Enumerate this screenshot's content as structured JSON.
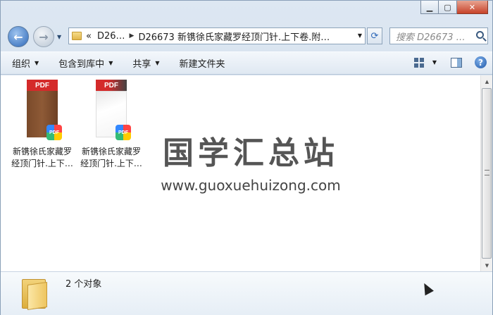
{
  "window": {
    "caption_buttons": [
      "minimize",
      "maximize",
      "close"
    ]
  },
  "address_bar": {
    "prefix": "«",
    "crumbs": [
      "D26…",
      "D26673 新镌徐氏家藏罗经顶门针.上下卷.附…"
    ]
  },
  "search": {
    "placeholder": "搜索 D26673 …"
  },
  "toolbar": {
    "organize": "组织",
    "include_in_library": "包含到库中",
    "share": "共享",
    "new_folder": "新建文件夹"
  },
  "files": [
    {
      "tag": "PDF",
      "badge": "PDF",
      "line1": "新镌徐氏家藏罗",
      "line2": "经顶门针.上下…"
    },
    {
      "tag": "PDF",
      "badge": "PDF",
      "line1": "新镌徐氏家藏罗",
      "line2": "经顶门针.上下…"
    }
  ],
  "watermark": {
    "title": "国学汇总站",
    "url": "www.guoxuehuizong.com"
  },
  "details": {
    "object_count": "2 个对象"
  },
  "colors": {
    "pdf_red": "#d42a2a",
    "frame": "#cfdcea",
    "folder_yellow": "#eec560"
  }
}
